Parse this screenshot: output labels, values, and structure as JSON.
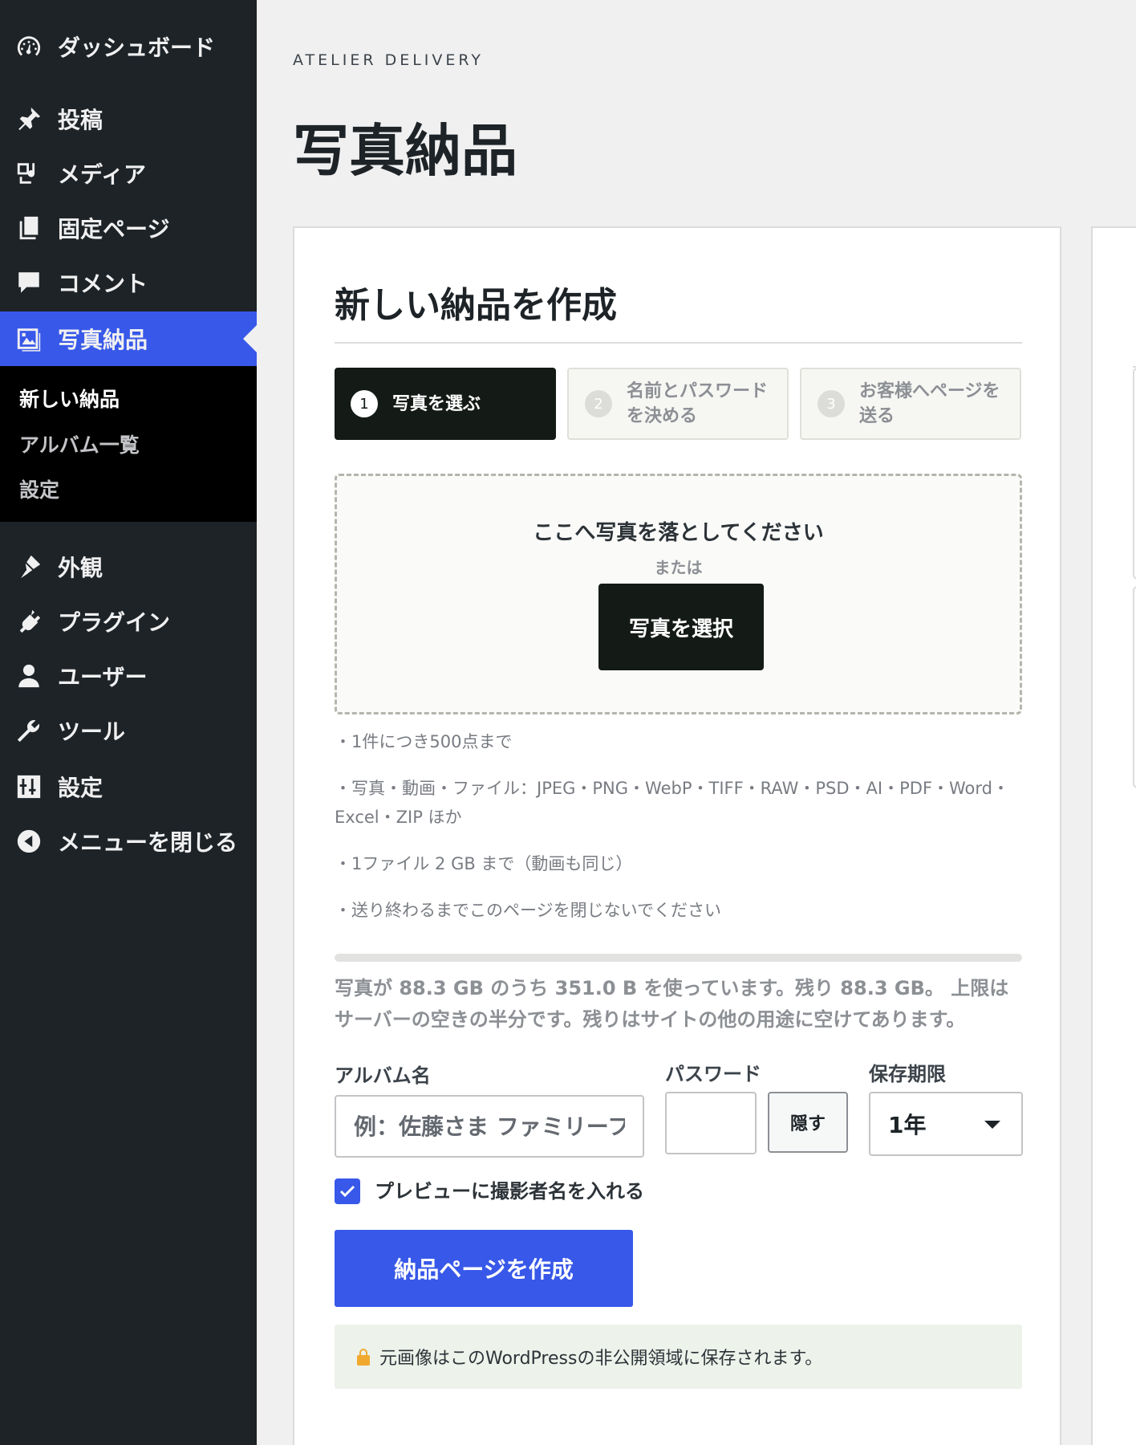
{
  "sidebar": {
    "menu": [
      {
        "label": "ダッシュボード",
        "icon": "dashboard-icon"
      },
      {
        "label": "投稿",
        "icon": "pin-icon"
      },
      {
        "label": "メディア",
        "icon": "media-icon"
      },
      {
        "label": "固定ページ",
        "icon": "pages-icon"
      },
      {
        "label": "コメント",
        "icon": "comment-icon"
      },
      {
        "label": "写真納品",
        "icon": "photo-icon"
      },
      {
        "label": "外観",
        "icon": "brush-icon"
      },
      {
        "label": "プラグイン",
        "icon": "plugin-icon"
      },
      {
        "label": "ユーザー",
        "icon": "user-icon"
      },
      {
        "label": "ツール",
        "icon": "wrench-icon"
      },
      {
        "label": "設定",
        "icon": "settings-icon"
      },
      {
        "label": "メニューを閉じる",
        "icon": "collapse-icon"
      }
    ],
    "submenu": [
      {
        "label": "新しい納品"
      },
      {
        "label": "アルバム一覧"
      },
      {
        "label": "設定"
      }
    ]
  },
  "header": {
    "brand": "ATELIER DELIVERY",
    "title": "写真納品"
  },
  "card": {
    "title": "新しい納品を作成",
    "steps": [
      {
        "num": "1",
        "label": "写真を選ぶ"
      },
      {
        "num": "2",
        "label": "名前とパスワードを決める"
      },
      {
        "num": "3",
        "label": "お客様へページを送る"
      }
    ],
    "dropzone": {
      "text": "ここへ写真を落としてください",
      "or": "または",
      "button": "写真を選択"
    },
    "notes": [
      "・1件につき500点まで",
      "・写真・動画・ファイル：JPEG・PNG・WebP・TIFF・RAW・PSD・AI・PDF・Word・Excel・ZIP ほか",
      "・1ファイル 2 GB まで（動画も同じ）",
      "・送り終わるまでこのページを閉じないでください"
    ],
    "storage": {
      "text": "写真が 88.3 GB のうち 351.0 B を使っています。残り 88.3 GB。 上限はサーバーの空きの半分です。残りはサイトの他の用途に空けてあります。",
      "used_fraction": 0
    },
    "form": {
      "album_label": "アルバム名",
      "album_placeholder": "例：佐藤さま ファミリーフォト",
      "password_label": "パスワード",
      "password_value": "",
      "hide_button": "隠す",
      "expiry_label": "保存期限",
      "expiry_value": "1年",
      "preview_checkbox_label": "プレビューに撮影者名を入れる",
      "preview_checked": true,
      "create_button": "納品ページを作成"
    },
    "secure_note": "元画像はこのWordPressの非公開領域に保存されます。"
  },
  "colors": {
    "accent": "#3858e9",
    "sidebar_bg": "#1d2327",
    "dark_button": "#141a16",
    "note_bg": "#edf2ea",
    "lock": "#f0a92e"
  }
}
